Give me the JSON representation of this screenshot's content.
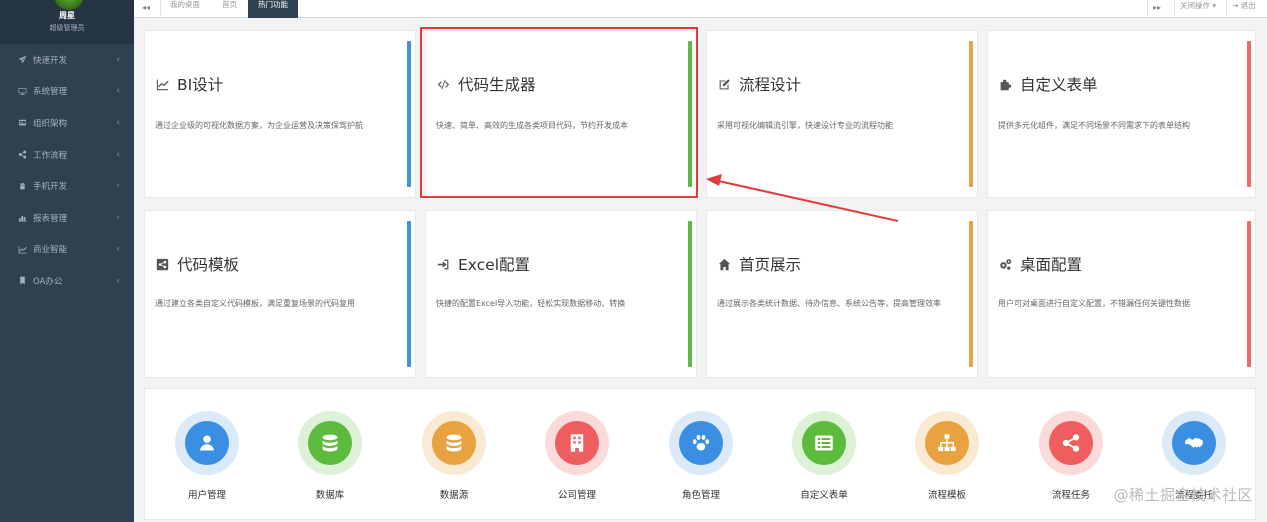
{
  "profile": {
    "name": "周星",
    "role": "超级管理员"
  },
  "sidebar": {
    "items": [
      {
        "label": "快速开发",
        "icon": "send-icon"
      },
      {
        "label": "系统管理",
        "icon": "desktop-icon"
      },
      {
        "label": "组织架构",
        "icon": "org-icon"
      },
      {
        "label": "工作流程",
        "icon": "share-icon"
      },
      {
        "label": "手机开发",
        "icon": "android-icon"
      },
      {
        "label": "报表管理",
        "icon": "bar-chart-icon"
      },
      {
        "label": "商业智能",
        "icon": "line-chart-icon"
      },
      {
        "label": "OA办公",
        "icon": "bookmark-icon"
      }
    ]
  },
  "tabbar": {
    "tabs": [
      {
        "label": "我的桌面"
      },
      {
        "label": "首页"
      },
      {
        "label": "热门功能",
        "active": true
      }
    ],
    "close_ops": "关闭操作",
    "logout": "退出"
  },
  "cards": [
    {
      "title": "BI设计",
      "desc": "通过企业级的可视化数据方案，为企业运营及决策保驾护航",
      "icon": "line-chart-icon",
      "color": "#3a94e0"
    },
    {
      "title": "代码生成器",
      "desc": "快速、简单、高效的生成各类项目代码，节约开发成本",
      "icon": "code-icon",
      "color": "#5fb946"
    },
    {
      "title": "流程设计",
      "desc": "采用可视化编辑流引擎，快速设计专业的流程功能",
      "icon": "edit-icon",
      "color": "#e8a34a"
    },
    {
      "title": "自定义表单",
      "desc": "提供多元化组件，满足不同场景不同需求下的表单结构",
      "icon": "puzzle-icon",
      "color": "#e96b6b"
    },
    {
      "title": "代码模板",
      "desc": "通过建立各类自定义代码模板，满足重复场景的代码复用",
      "icon": "share-square-icon",
      "color": "#3a94e0"
    },
    {
      "title": "Excel配置",
      "desc": "快捷的配置Excel导入功能，轻松实现数据移动、转换",
      "icon": "sign-in-icon",
      "color": "#5fb946"
    },
    {
      "title": "首页展示",
      "desc": "通过展示各类统计数据、待办信息、系统公告等，提高管理效率",
      "icon": "home-icon",
      "color": "#e8a34a"
    },
    {
      "title": "桌面配置",
      "desc": "用户可对桌面进行自定义配置，不错漏任何关键性数据",
      "icon": "gears-icon",
      "color": "#e96b6b"
    }
  ],
  "quick": [
    {
      "label": "用户管理",
      "icon": "user-icon",
      "color": "#3b8fe3",
      "bg": "#dbeaf9"
    },
    {
      "label": "数据库",
      "icon": "database-icon",
      "color": "#5cba3c",
      "bg": "#ddf1d6"
    },
    {
      "label": "数据源",
      "icon": "database-icon",
      "color": "#e8a23f",
      "bg": "#fbead3"
    },
    {
      "label": "公司管理",
      "icon": "building-icon",
      "color": "#ee5e5e",
      "bg": "#fbdada"
    },
    {
      "label": "角色管理",
      "icon": "paw-icon",
      "color": "#3b8fe3",
      "bg": "#dbeaf9"
    },
    {
      "label": "自定义表单",
      "icon": "list-icon",
      "color": "#5cba3c",
      "bg": "#ddf1d6"
    },
    {
      "label": "流程模板",
      "icon": "sitemap-icon",
      "color": "#e8a23f",
      "bg": "#fbead3"
    },
    {
      "label": "流程任务",
      "icon": "share-alt-icon",
      "color": "#ee5e5e",
      "bg": "#fbdada"
    },
    {
      "label": "流程委托",
      "icon": "handshake-icon",
      "color": "#3b8fe3",
      "bg": "#dbeaf9"
    }
  ],
  "watermark": "@稀土掘金技术社区"
}
